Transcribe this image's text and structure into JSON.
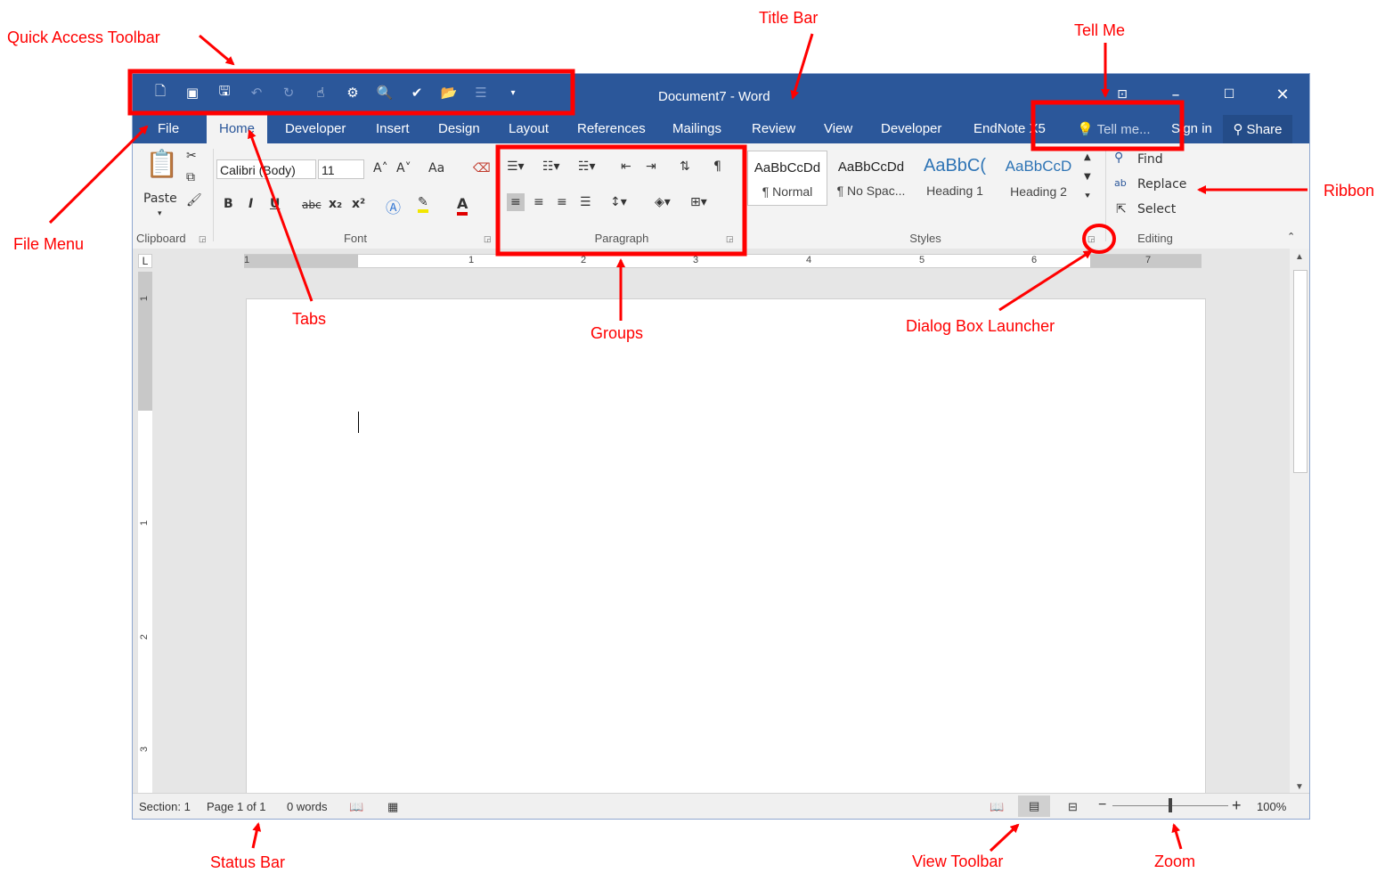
{
  "annotations": {
    "title_bar": "Title Bar",
    "quick_access_toolbar": "Quick Access Toolbar",
    "tell_me": "Tell Me",
    "file_menu": "File Menu",
    "ribbon": "Ribbon",
    "tabs": "Tabs",
    "groups": "Groups",
    "dialog_box_launcher": "Dialog Box Launcher",
    "status_bar": "Status Bar",
    "view_toolbar": "View Toolbar",
    "zoom": "Zoom",
    "color": "#ff0000"
  },
  "window": {
    "title": "Document7 - Word",
    "accent": "#2b579a"
  },
  "quick_access": [
    "new-document-icon",
    "open-template-icon",
    "save-icon",
    "undo-icon",
    "redo-icon",
    "touch-mode-icon",
    "share-icon",
    "print-preview-icon",
    "spelling-check-icon",
    "open-folder-icon",
    "form-icon",
    "customize-qat-icon"
  ],
  "tabs": [
    "File",
    "Home",
    "Developer",
    "Insert",
    "Design",
    "Layout",
    "References",
    "Mailings",
    "Review",
    "View",
    "Developer",
    "EndNote X5"
  ],
  "tell_me": "Tell me...",
  "sign_in": "Sign in",
  "share": "Share",
  "ribbon": {
    "clipboard": {
      "label": "Clipboard",
      "paste": "Paste"
    },
    "font": {
      "label": "Font",
      "name": "Calibri (Body)",
      "size": "11",
      "change_case": "Aa",
      "bold": "B",
      "italic": "I",
      "underline": "U",
      "strike": "abc",
      "sub": "x₂",
      "sup": "x²",
      "color_a": "A"
    },
    "paragraph": {
      "label": "Paragraph"
    },
    "styles": {
      "label": "Styles",
      "items": [
        {
          "preview": "AaBbCcDd",
          "name": "¶ Normal"
        },
        {
          "preview": "AaBbCcDd",
          "name": "¶ No Spac..."
        },
        {
          "preview": "AaBbC(",
          "name": "Heading 1"
        },
        {
          "preview": "AaBbCcD",
          "name": "Heading 2"
        }
      ]
    },
    "editing": {
      "label": "Editing",
      "find": "Find",
      "replace": "Replace",
      "select": "Select"
    }
  },
  "ruler": [
    "1",
    "1",
    "2",
    "3",
    "4",
    "5",
    "6",
    "7"
  ],
  "vruler": [
    "1",
    "1",
    "2",
    "3"
  ],
  "tab_selector": "L",
  "status": {
    "section": "Section: 1",
    "page": "Page 1 of 1",
    "words": "0 words",
    "zoom_minus": "−",
    "zoom_plus": "+",
    "zoom": "100%"
  }
}
